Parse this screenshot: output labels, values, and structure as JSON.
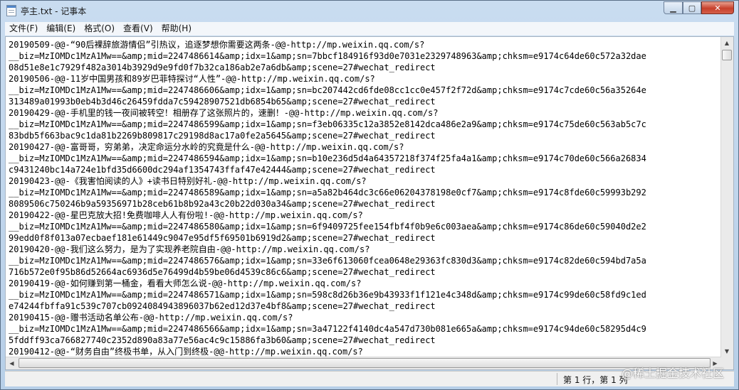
{
  "window": {
    "title": "亭主.txt - 记事本",
    "min_glyph": "▁",
    "max_glyph": "▢",
    "close_glyph": "✕"
  },
  "menu": [
    "文件(F)",
    "编辑(E)",
    "格式(O)",
    "查看(V)",
    "帮助(H)"
  ],
  "lines": [
    "20190509-@@-“90后裸辞旅游情侣”引热议，追逐梦想你需要这两条-@@-http://mp.weixin.qq.com/s?",
    "__biz=MzIOMDc1MzA1Mw==&amp;mid=2247486614&amp;idx=1&amp;sn=7bbcf184916f93d0e7031e2329748963&amp;chksm=e9174c64de60c572a32dae",
    "08d51e8e1c7929f482a3014b3929d9e9fd0f7b32ca186ab2e7a6db&amp;scene=27#wechat_redirect",
    "20190506-@@-11岁中国男孩和89岁巴菲特探讨“人性”-@@-http://mp.weixin.qq.com/s?",
    "__biz=MzIOMDc1MzA1Mw==&amp;mid=2247486606&amp;idx=1&amp;sn=bc207442cd6fde08cc1cc0e457f2f72d&amp;chksm=e9174c7cde60c56a35264e",
    "313489a01993b0eb4b3d46c26459fdda7c59428907521db6854b65&amp;scene=27#wechat_redirect",
    "20190429-@@-手机里的钱一夜间被转空！相册存了这张照片的，速删！-@@-http://mp.weixin.qq.com/s?",
    "__biz=MzIOMDc1MzA1Mw==&amp;mid=2247486599&amp;idx=1&amp;sn=f3eb06335c12a3852e8142dca486e2a9&amp;chksm=e9174c75de60c563ab5c7c",
    "83bdb5f663bac9c1da81b2269b809817c29198d8ac17a0fe2a5645&amp;scene=27#wechat_redirect",
    "20190427-@@-富哥哥，穷弟弟，决定命运分水岭的究竟是什么-@@-http://mp.weixin.qq.com/s?",
    "__biz=MzIOMDc1MzA1Mw==&amp;mid=2247486594&amp;idx=1&amp;sn=b10e236d5d4a64357218f374f25fa4a1&amp;chksm=e9174c70de60c566a26834",
    "c9431240bc14a724e1bfd35d6600dc294af1354743ffaf47e42444&amp;scene=27#wechat_redirect",
    "20190423-@@-《我害怕阅读的人》+读书日特别好礼-@@-http://mp.weixin.qq.com/s?",
    "__biz=MzIOMDc1MzA1Mw==&amp;mid=2247486589&amp;idx=1&amp;sn=a5a82b464dc3c66e06204378198e0cf7&amp;chksm=e9174c8fde60c59993b292",
    "8089506c750246b9a59356971b28ceb61b8b92a43c20b22d030a34&amp;scene=27#wechat_redirect",
    "20190422-@@-星巴克放大招!免费咖啡人人有份啦!-@@-http://mp.weixin.qq.com/s?",
    "__biz=MzIOMDc1MzA1Mw==&amp;mid=2247486580&amp;idx=1&amp;sn=6f9409725fee154fbf4f0b9e6c003aea&amp;chksm=e9174c86de60c59040d2e2",
    "99edd0f8f013a07ecbaef181e61449c9047e95df5f69501b6919d2&amp;scene=27#wechat_redirect",
    "20190420-@@-我们这么努力，是为了实现养老院自由-@@-http://mp.weixin.qq.com/s?",
    "__biz=MzIOMDc1MzA1Mw==&amp;mid=2247486576&amp;idx=1&amp;sn=33e6f613060fcea0648e29363fc830d3&amp;chksm=e9174c82de60c594bd7a5a",
    "716b572e0f95b86d52664ac6936d5e76499d4b59be06d4539c86c6&amp;scene=27#wechat_redirect",
    "20190419-@@-如何赚到第一桶金，看看大师怎么说-@@-http://mp.weixin.qq.com/s?",
    "__biz=MzIOMDc1MzA1Mw==&amp;mid=2247486571&amp;idx=1&amp;sn=598c8d26b36e9b43933f1f121e4c348d&amp;chksm=e9174c99de60c58fd9c1ed",
    "e74244fbffa91c539c707cb0924084943896037b62ed12d37e4bf8&amp;scene=27#wechat_redirect",
    "20190415-@@-赠书活动名单公布-@@-http://mp.weixin.qq.com/s?",
    "__biz=MzIOMDc1MzA1Mw==&amp;mid=2247486566&amp;idx=1&amp;sn=3a47122f4140dc4a547d730b081e665a&amp;chksm=e9174c94de60c58295d4c9",
    "5fddff93ca766827740c2352d890a83a77e56ac4c9c15886fa3b60&amp;scene=27#wechat_redirect",
    "20190412-@@-“财务自由”终极书单，从入门到终极-@@-http://mp.weixin.qq.com/s?"
  ],
  "status": {
    "position": "第 1 行，第 1 列"
  },
  "watermark": "@稀土掘金技术社区"
}
